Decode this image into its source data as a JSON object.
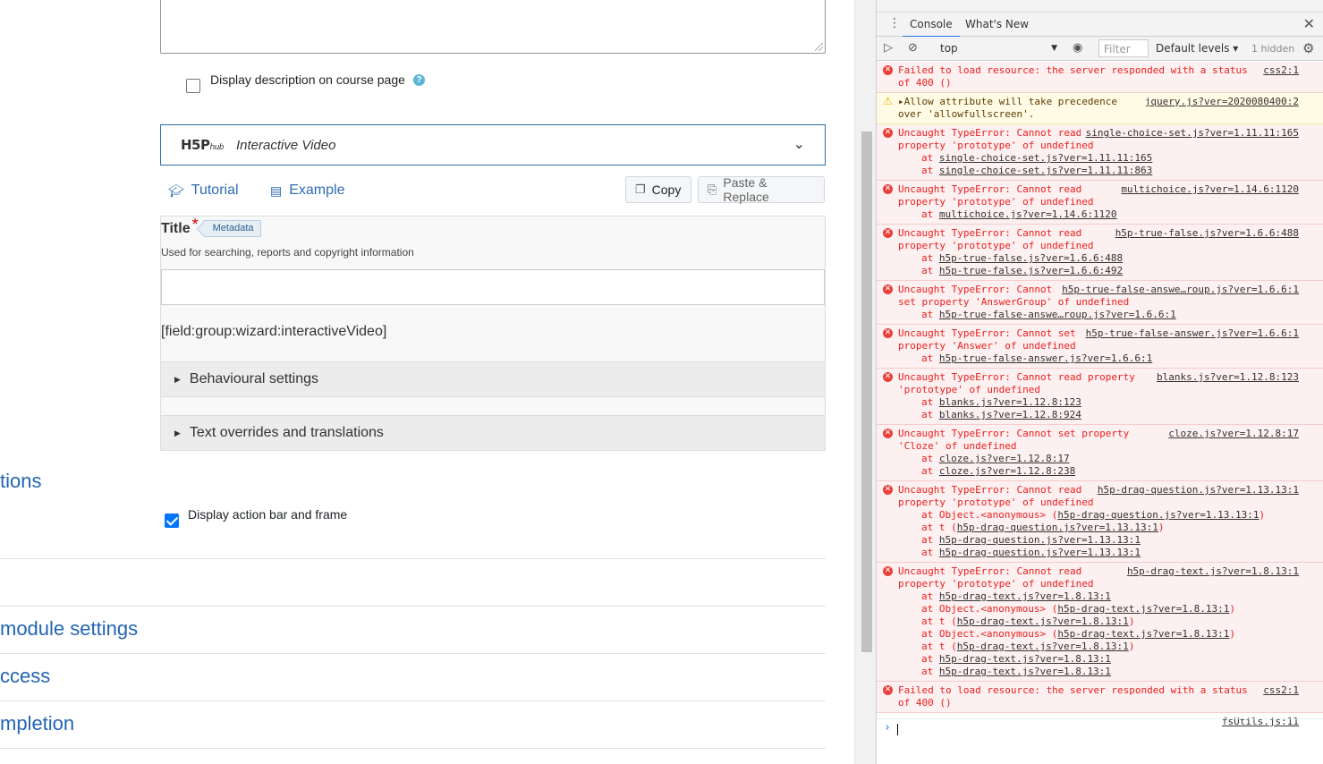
{
  "form": {
    "display_description_label": "Display description on course page",
    "h5p_hub": {
      "logo": "H5P",
      "logo_suffix": "hub",
      "content_type": "Interactive Video"
    },
    "links": {
      "tutorial": "Tutorial",
      "example": "Example"
    },
    "buttons": {
      "copy": "Copy",
      "paste_replace": "Paste & Replace"
    },
    "title_field": {
      "label": "Title",
      "required_mark": "*",
      "metadata": "Metadata",
      "description": "Used for searching, reports and copyright information",
      "value": ""
    },
    "field_group_placeholder": "[field:group:wizard:interactiveVideo]",
    "accordions": [
      "Behavioural settings",
      "Text overrides and translations"
    ],
    "options_heading": "tions",
    "display_action_bar_label": "Display action bar and frame",
    "sections": [
      "module settings",
      "ccess",
      "mpletion"
    ]
  },
  "devtools": {
    "tabs": [
      "Console",
      "What's New"
    ],
    "active_tab": "Console",
    "context": "top",
    "filter_placeholder": "Filter",
    "levels": "Default levels",
    "hidden_count": "1 hidden",
    "messages": [
      {
        "type": "err",
        "lines": [
          "Failed to load resource: the server responded with a status",
          "of 400 ()"
        ],
        "source": "css2:1",
        "stack": []
      },
      {
        "type": "warn",
        "lines": [
          "▸Allow attribute will take precedence",
          "over 'allowfullscreen'."
        ],
        "source": "jquery.js?ver=2020080400:2",
        "stack": []
      },
      {
        "type": "err",
        "lines": [
          "Uncaught TypeError: Cannot read",
          "property 'prototype' of undefined"
        ],
        "source": "single-choice-set.js?ver=1.11.11:165",
        "stack": [
          [
            "at ",
            "single-choice-set.js?ver=1.11.11:165",
            ""
          ],
          [
            "at ",
            "single-choice-set.js?ver=1.11.11:863",
            ""
          ]
        ]
      },
      {
        "type": "err",
        "lines": [
          "Uncaught TypeError: Cannot read",
          "property 'prototype' of undefined"
        ],
        "source": "multichoice.js?ver=1.14.6:1120",
        "stack": [
          [
            "at ",
            "multichoice.js?ver=1.14.6:1120",
            ""
          ]
        ]
      },
      {
        "type": "err",
        "lines": [
          "Uncaught TypeError: Cannot read",
          "property 'prototype' of undefined"
        ],
        "source": "h5p-true-false.js?ver=1.6.6:488",
        "stack": [
          [
            "at ",
            "h5p-true-false.js?ver=1.6.6:488",
            ""
          ],
          [
            "at ",
            "h5p-true-false.js?ver=1.6.6:492",
            ""
          ]
        ]
      },
      {
        "type": "err",
        "lines": [
          "Uncaught TypeError: Cannot",
          "set property 'AnswerGroup' of undefined"
        ],
        "source": "h5p-true-false-answe…roup.js?ver=1.6.6:1",
        "stack": [
          [
            "at ",
            "h5p-true-false-answe…roup.js?ver=1.6.6:1",
            ""
          ]
        ]
      },
      {
        "type": "err",
        "lines": [
          "Uncaught TypeError: Cannot set",
          "property 'Answer' of undefined"
        ],
        "source": "h5p-true-false-answer.js?ver=1.6.6:1",
        "stack": [
          [
            "at ",
            "h5p-true-false-answer.js?ver=1.6.6:1",
            ""
          ]
        ]
      },
      {
        "type": "err",
        "lines": [
          "Uncaught TypeError: Cannot read property",
          "'prototype' of undefined"
        ],
        "source": "blanks.js?ver=1.12.8:123",
        "stack": [
          [
            "at ",
            "blanks.js?ver=1.12.8:123",
            ""
          ],
          [
            "at ",
            "blanks.js?ver=1.12.8:924",
            ""
          ]
        ]
      },
      {
        "type": "err",
        "lines": [
          "Uncaught TypeError: Cannot set property",
          "'Cloze' of undefined"
        ],
        "source": "cloze.js?ver=1.12.8:17",
        "stack": [
          [
            "at ",
            "cloze.js?ver=1.12.8:17",
            ""
          ],
          [
            "at ",
            "cloze.js?ver=1.12.8:238",
            ""
          ]
        ]
      },
      {
        "type": "err",
        "lines": [
          "Uncaught TypeError: Cannot read",
          "property 'prototype' of undefined"
        ],
        "source": "h5p-drag-question.js?ver=1.13.13:1",
        "stack": [
          [
            "at Object.<anonymous> (",
            "h5p-drag-question.js?ver=1.13.13:1",
            ")"
          ],
          [
            "at t (",
            "h5p-drag-question.js?ver=1.13.13:1",
            ")"
          ],
          [
            "at ",
            "h5p-drag-question.js?ver=1.13.13:1",
            ""
          ],
          [
            "at ",
            "h5p-drag-question.js?ver=1.13.13:1",
            ""
          ]
        ]
      },
      {
        "type": "err",
        "lines": [
          "Uncaught TypeError: Cannot read",
          "property 'prototype' of undefined"
        ],
        "source": "h5p-drag-text.js?ver=1.8.13:1",
        "stack": [
          [
            "at ",
            "h5p-drag-text.js?ver=1.8.13:1",
            ""
          ],
          [
            "at Object.<anonymous> (",
            "h5p-drag-text.js?ver=1.8.13:1",
            ")"
          ],
          [
            "at t (",
            "h5p-drag-text.js?ver=1.8.13:1",
            ")"
          ],
          [
            "at Object.<anonymous> (",
            "h5p-drag-text.js?ver=1.8.13:1",
            ")"
          ],
          [
            "at t (",
            "h5p-drag-text.js?ver=1.8.13:1",
            ")"
          ],
          [
            "at ",
            "h5p-drag-text.js?ver=1.8.13:1",
            ""
          ],
          [
            "at ",
            "h5p-drag-text.js?ver=1.8.13:1",
            ""
          ]
        ]
      },
      {
        "type": "err",
        "lines": [
          "Failed to load resource: the server responded with a status",
          "of 400 ()"
        ],
        "source": "css2:1",
        "stack": []
      },
      {
        "type": "info",
        "lines": [
          ""
        ],
        "source": "fsUtils.js:11",
        "stack": []
      }
    ]
  }
}
